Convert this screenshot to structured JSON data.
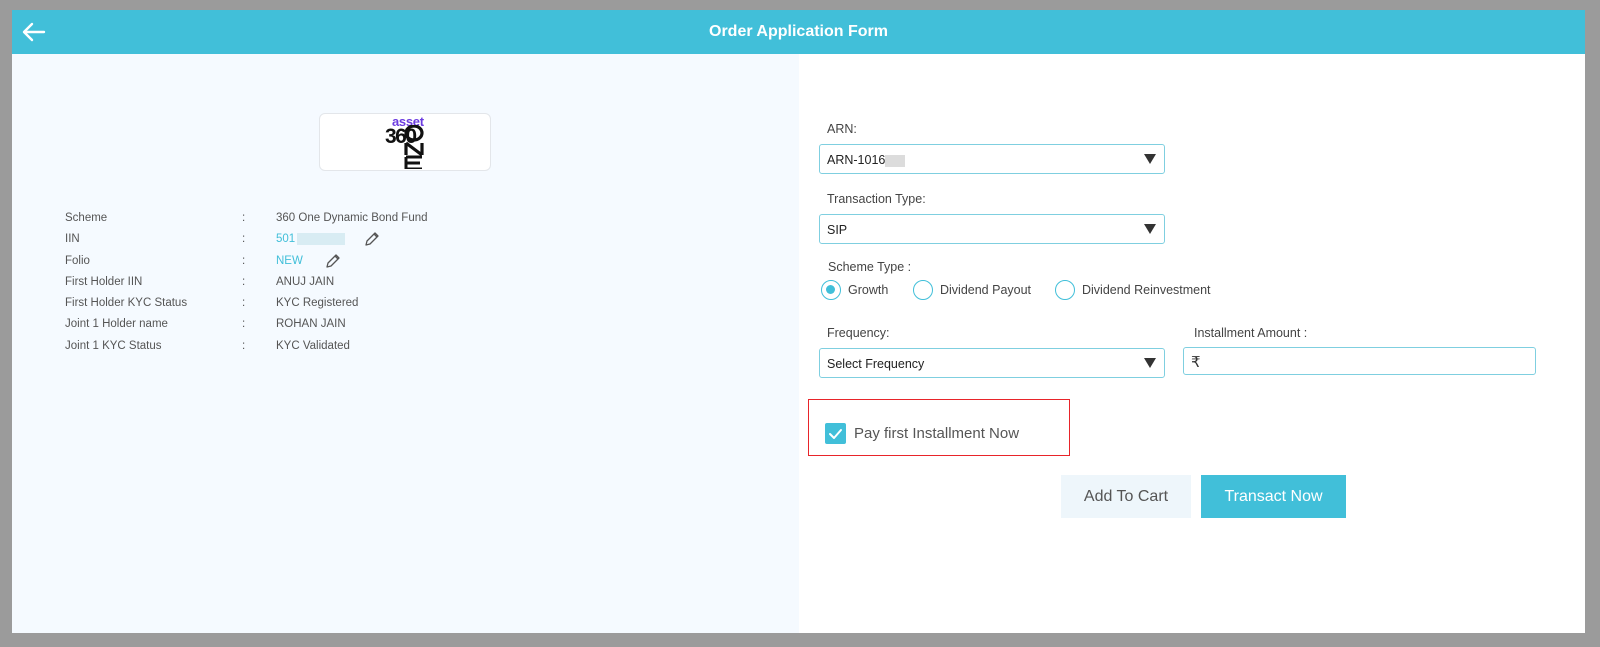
{
  "header": {
    "title": "Order Application Form"
  },
  "logo": {
    "asset": "asset",
    "number": "360",
    "one": "ONE"
  },
  "info": {
    "separator": ":",
    "rows": [
      {
        "label": "Scheme",
        "value": "360 One Dynamic Bond Fund"
      },
      {
        "label": "IIN",
        "value": "501"
      },
      {
        "label": "Folio",
        "value": "NEW"
      },
      {
        "label": "First Holder IIN",
        "value": "ANUJ JAIN"
      },
      {
        "label": "First Holder KYC Status",
        "value": "KYC Registered"
      },
      {
        "label": "Joint 1 Holder name",
        "value": "ROHAN JAIN"
      },
      {
        "label": "Joint 1 KYC Status",
        "value": "KYC Validated"
      }
    ]
  },
  "form": {
    "arn_label": "ARN:",
    "arn_value": "ARN-1016",
    "transaction_type_label": "Transaction Type:",
    "transaction_type_value": "SIP",
    "scheme_type_label": "Scheme Type :",
    "scheme_types": [
      {
        "label": "Growth",
        "selected": true
      },
      {
        "label": "Dividend Payout",
        "selected": false
      },
      {
        "label": "Dividend Reinvestment",
        "selected": false
      }
    ],
    "frequency_label": "Frequency:",
    "frequency_value": "Select Frequency",
    "installment_label": "Installment Amount :",
    "currency_symbol": "₹",
    "installment_value": "",
    "pay_first_label": "Pay first Installment Now",
    "pay_first_checked": true
  },
  "buttons": {
    "add_to_cart": "Add To Cart",
    "transact_now": "Transact Now"
  },
  "colors": {
    "accent": "#41bfd9",
    "highlight": "#e8242a",
    "brand_purple": "#6c3ce0"
  }
}
